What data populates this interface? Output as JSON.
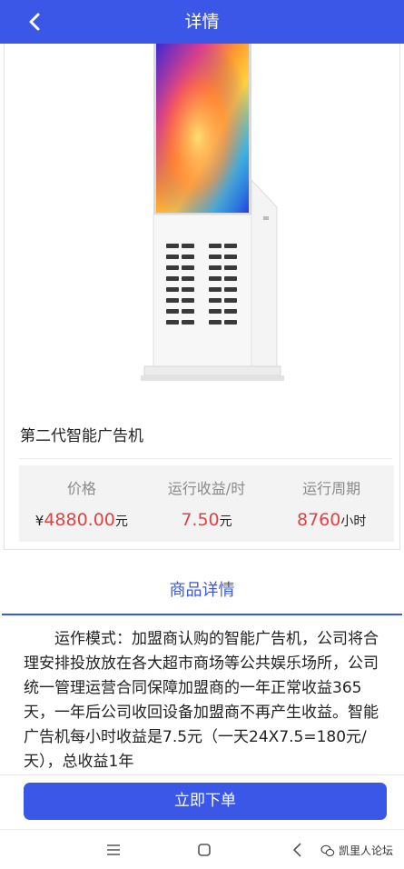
{
  "header": {
    "title": "详情",
    "back_icon": "chevron-left-icon"
  },
  "product": {
    "name": "第二代智能广告机",
    "stats": [
      {
        "label": "价格",
        "prefix": "¥",
        "value": "4880.00",
        "unit": "元"
      },
      {
        "label": "运行收益/时",
        "prefix": "",
        "value": "7.50",
        "unit": "元"
      },
      {
        "label": "运行周期",
        "prefix": "",
        "value": "8760",
        "unit": "小时"
      }
    ]
  },
  "details": {
    "tab_label": "商品详情",
    "text": "运作模式：加盟商认购的智能广告机，公司将合理安排投放放在各大超市商场等公共娱乐场所，公司统一管理运营合同保障加盟商的一年正常收益365天，一年后公司收回设备加盟商不再产生收益。智能广告机每小时收益是7.5元（一天24X7.5=180元/天），总收益1年"
  },
  "actions": {
    "order_label": "立即下单"
  },
  "system_nav": {
    "icons": [
      "menu-icon",
      "home-square-icon",
      "back-triangle-icon"
    ]
  },
  "watermark": {
    "text": "凯里人论坛"
  },
  "colors": {
    "accent": "#3a57e8",
    "price": "#e04343"
  }
}
